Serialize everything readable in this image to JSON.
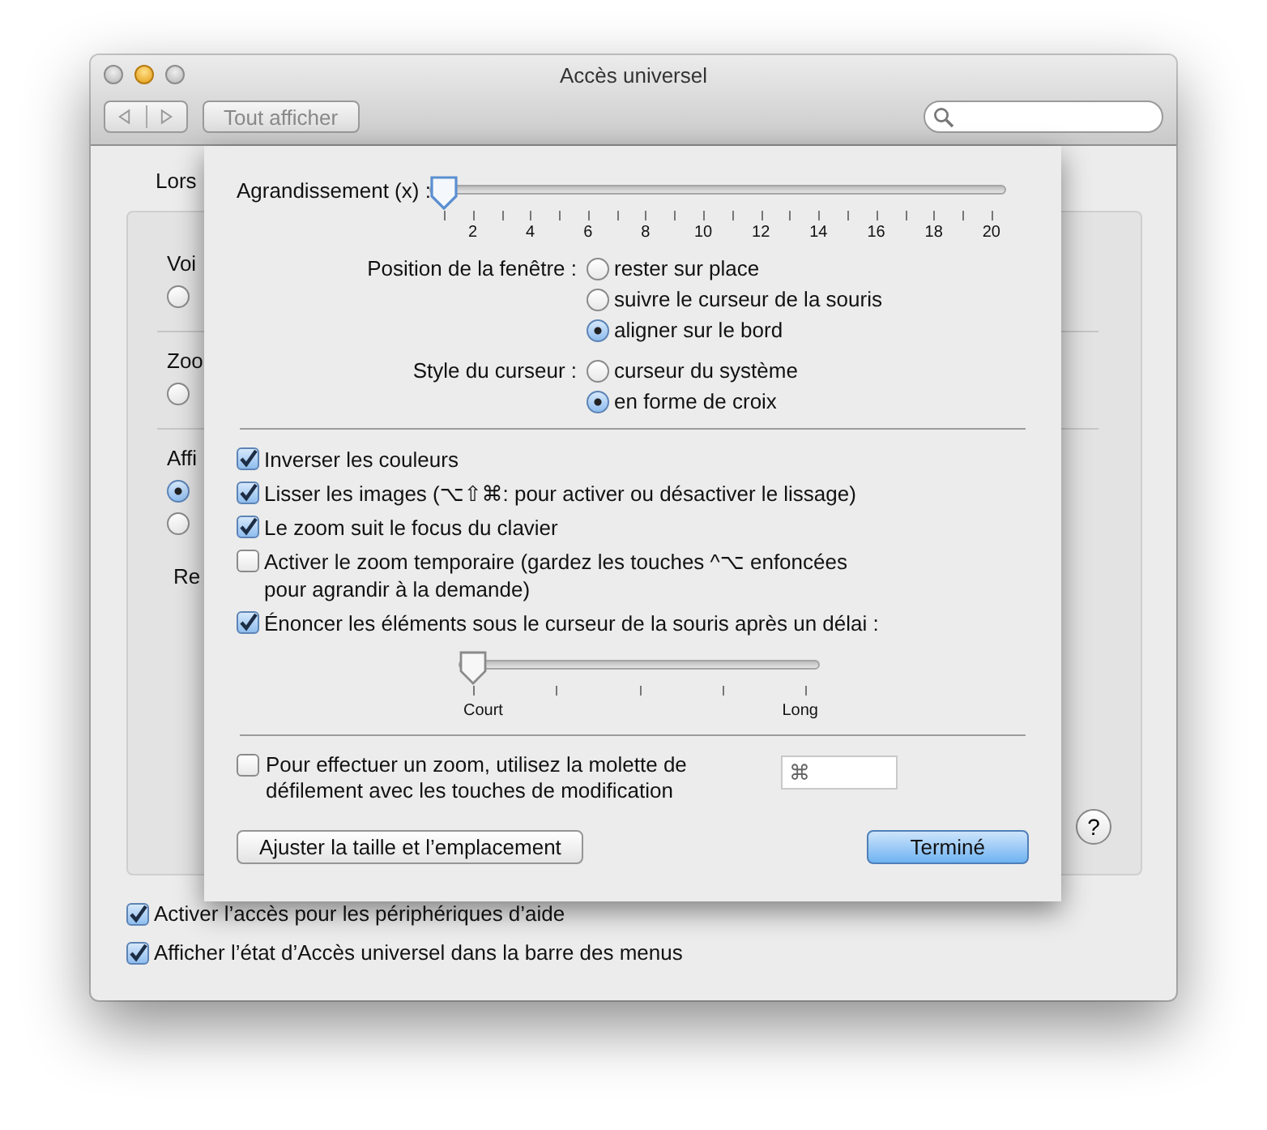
{
  "window": {
    "title": "Accès universel"
  },
  "toolbar": {
    "show_all_button": "Tout afficher"
  },
  "background": {
    "intro": "Lors",
    "sections": [
      {
        "label": "Voi",
        "radios": [
          {
            "selected": false
          }
        ]
      },
      {
        "label": "Zoo",
        "radios": [
          {
            "selected": false
          }
        ]
      },
      {
        "label": "Affi",
        "radios": [
          {
            "selected": true
          },
          {
            "selected": false
          }
        ]
      }
    ],
    "contrast_label": "Re",
    "help_button": "?"
  },
  "sheet": {
    "magnification": {
      "label": "Agrandissement (x) :",
      "level": 0,
      "ticks": [
        "2",
        "4",
        "6",
        "8",
        "10",
        "12",
        "14",
        "16",
        "18",
        "20"
      ]
    },
    "window_position": {
      "label": "Position de la fenêtre :",
      "options": [
        {
          "label": "rester sur place",
          "selected": false
        },
        {
          "label": "suivre le curseur de la souris",
          "selected": false
        },
        {
          "label": "aligner sur le bord",
          "selected": true
        }
      ]
    },
    "cursor_style": {
      "label": "Style du curseur :",
      "options": [
        {
          "label": "curseur du système",
          "selected": false
        },
        {
          "label": "en forme de croix",
          "selected": true
        }
      ]
    },
    "options": [
      {
        "label": "Inverser les couleurs",
        "checked": true
      },
      {
        "label": "Lisser les images (⌥⇧⌘: pour activer ou désactiver le lissage)",
        "checked": true
      },
      {
        "label": "Le zoom suit le focus du clavier",
        "checked": true
      },
      {
        "label": "Activer le zoom temporaire (gardez les touches ^⌥ enfoncées pour agrandir à la demande)",
        "checked": false
      },
      {
        "label": "Énoncer les éléments sous le curseur de la souris après un délai :",
        "checked": true
      }
    ],
    "delay": {
      "level": 0,
      "min_label": "Court",
      "max_label": "Long"
    },
    "scroll_zoom": {
      "label": "Pour effectuer un zoom, utilisez la molette de défilement avec les touches de modification",
      "checked": false,
      "modifier": "⌘"
    },
    "buttons": [
      {
        "label": "Ajuster la taille et l’emplacement",
        "kind": "normal"
      },
      {
        "label": "Terminé",
        "kind": "default"
      }
    ]
  },
  "bottom_checkboxes": [
    {
      "label": "Activer l’accès pour les périphériques d’aide",
      "checked": true
    },
    {
      "label": "Afficher l’état d’Accès universel dans la barre des menus",
      "checked": true
    }
  ]
}
